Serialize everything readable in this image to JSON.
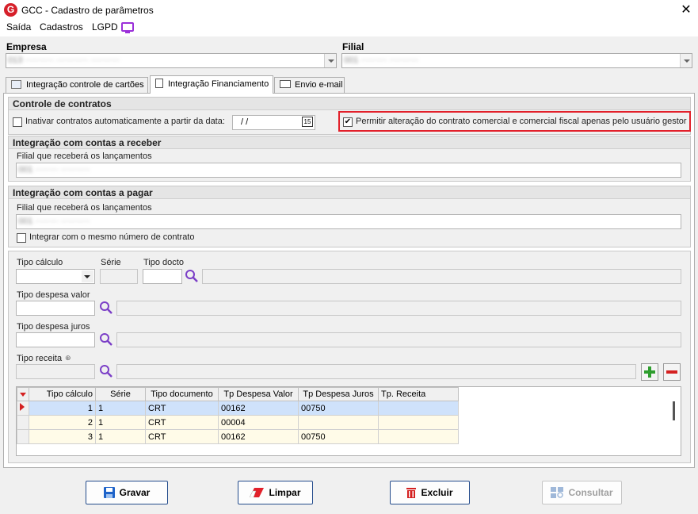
{
  "window": {
    "title": "GCC - Cadastro de parâmetros",
    "app_icon": "G"
  },
  "menu": [
    "Saída",
    "Cadastros",
    "LGPD"
  ],
  "empresa": {
    "label": "Empresa",
    "value": "013 ·········· ··········· ··········"
  },
  "filial": {
    "label": "Filial",
    "value": "001 ········· ··········"
  },
  "tabs": [
    "Integração controle de cartões",
    "Integração Financiamento",
    "Envio e-mail"
  ],
  "controle": {
    "title": "Controle de contratos",
    "inativar_label": "Inativar contratos automaticamente a partir da data:",
    "date_value": "/ /",
    "permitir_label": "Permitir alteração do contrato comercial e comercial fiscal apenas pelo usuário gestor",
    "permitir_checked": "✔"
  },
  "receber": {
    "title": "Integração com contas a receber",
    "filial_label": "Filial que receberá os lançamentos",
    "filial_value": "001 ········ ··········"
  },
  "pagar": {
    "title": "Integração com contas a pagar",
    "filial_label": "Filial que receberá os lançamentos",
    "filial_value": "001 ········ ··········",
    "mesmo_numero_label": "Integrar com o mesmo número de contrato"
  },
  "tipos": {
    "tipo_calculo": "Tipo cálculo",
    "serie": "Série",
    "tipo_docto": "Tipo docto",
    "tipo_despesa_valor": "Tipo despesa valor",
    "tipo_despesa_juros": "Tipo despesa juros",
    "tipo_receita": "Tipo receita"
  },
  "grid": {
    "columns": [
      "Tipo cálculo",
      "Série",
      "Tipo documento",
      "Tp Despesa Valor",
      "Tp Despesa Juros",
      "Tp. Receita"
    ],
    "rows": [
      [
        "1",
        "1",
        "CRT",
        "00162",
        "00750",
        ""
      ],
      [
        "2",
        "1",
        "CRT",
        "00004",
        "",
        ""
      ],
      [
        "3",
        "1",
        "CRT",
        "00162",
        "00750",
        ""
      ]
    ]
  },
  "buttons": {
    "gravar": "Gravar",
    "limpar": "Limpar",
    "excluir": "Excluir",
    "consultar": "Consultar"
  },
  "colors": {
    "accent": "#e2202a",
    "selection": "#cfe2fb",
    "button_border": "#244c8c"
  }
}
